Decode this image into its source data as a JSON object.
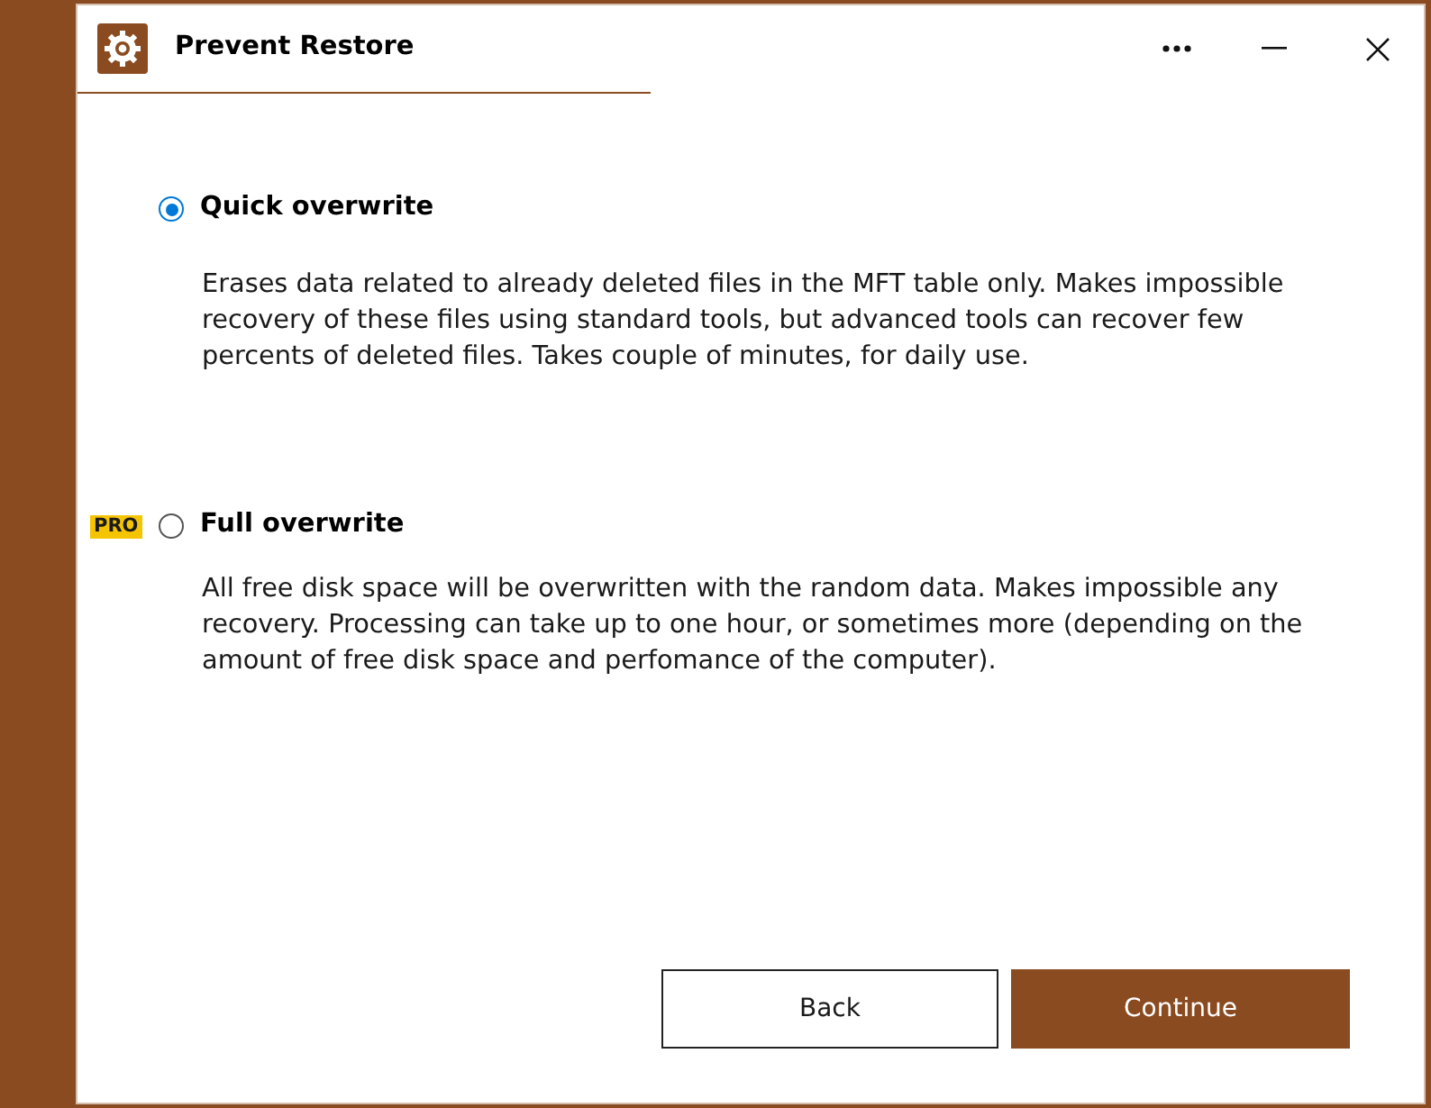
{
  "window": {
    "title": "Prevent Restore"
  },
  "options": [
    {
      "label": "Quick overwrite",
      "selected": true,
      "description": "Erases data related to already deleted files in the MFT table only. Makes impossible recovery of these files using standard tools, but advanced tools can recover few percents of deleted files. Takes couple of minutes, for daily use."
    },
    {
      "badge": "PRO",
      "label": "Full overwrite",
      "selected": false,
      "description": "All free disk space will be overwritten with the random data. Makes impossible any recovery. Processing can take up to one hour, or sometimes more (depending on the amount of free disk space and perfomance of the computer)."
    }
  ],
  "buttons": [
    {
      "label": "Back",
      "kind": "secondary"
    },
    {
      "label": "Continue",
      "kind": "primary"
    }
  ]
}
